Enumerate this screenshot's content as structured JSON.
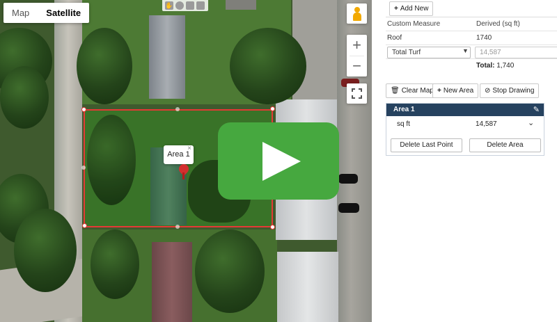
{
  "map": {
    "toggle": {
      "map_label": "Map",
      "satellite_label": "Satellite"
    },
    "zoom": {
      "in_label": "+",
      "out_label": "−"
    },
    "polygon_label": "Area 1",
    "bubble_close": "×",
    "colors": {
      "polygon_stroke": "#e53935",
      "play_button": "#46a83f"
    }
  },
  "panel": {
    "add_new_label": "Add New",
    "table": {
      "headers": [
        "Custom Measure",
        "Derived (sq ft)"
      ],
      "rows": [
        {
          "measure": "Roof",
          "value": "1740"
        }
      ],
      "select": {
        "selected": "Total Turf",
        "value": "14,587"
      },
      "total_label": "Total:",
      "total_value": "1,740"
    },
    "actions": {
      "clear_map": "Clear Map",
      "new_area": "New Area",
      "stop_drawing": "Stop Drawing"
    },
    "area_card": {
      "title": "Area 1",
      "unit": "sq ft",
      "value": "14,587",
      "delete_last_point": "Delete Last Point",
      "delete_area": "Delete Area"
    }
  }
}
